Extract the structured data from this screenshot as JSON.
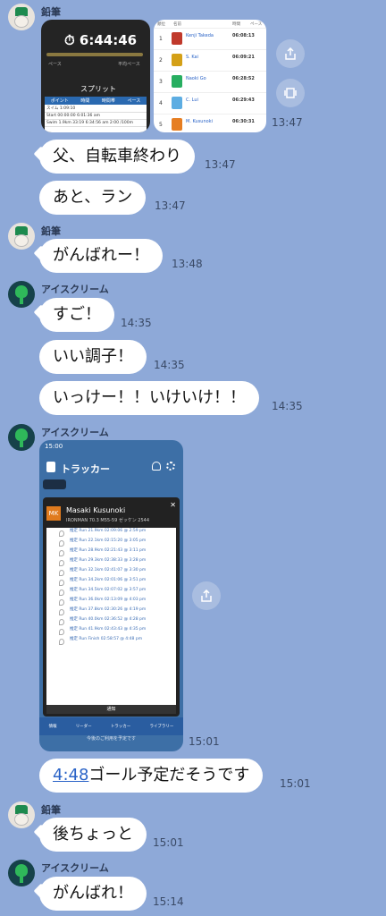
{
  "users": {
    "pencil": "鉛筆",
    "ice": "アイスクリーム"
  },
  "shot1": {
    "clock": "⏱ 6:44:46",
    "split_title": "スプリット",
    "pace_label": "ペース",
    "avg_pace_label": "平均ペース",
    "table_headers": [
      "ポイント",
      "時間",
      "時間帯",
      "ペース"
    ],
    "rows": [
      {
        "text": "スイム 1:09:10"
      },
      {
        "text": "Start 00:00:00  6:01:36 am"
      },
      {
        "text": "Swim 1.9km 33:19  6:34:56 am  2:00 /100m"
      }
    ]
  },
  "shot2": {
    "header": [
      "順位",
      "名前",
      "時間",
      "ペース"
    ],
    "rows": [
      {
        "rank": "1",
        "name": "Kenji Takeda",
        "time": "06:08:13",
        "color": "#c0392b"
      },
      {
        "rank": "2",
        "name": "S. Kai",
        "time": "06:09:21",
        "color": "#d4a017"
      },
      {
        "rank": "3",
        "name": "Naoki Go",
        "time": "06:28:52",
        "color": "#27ae60"
      },
      {
        "rank": "4",
        "name": "C. Lui",
        "time": "06:29:43",
        "color": "#5dade2"
      },
      {
        "rank": "5",
        "name": "M. Kusunoki",
        "time": "06:30:31",
        "color": "#e67e22"
      }
    ]
  },
  "messages": {
    "m1": {
      "text": "父、自転車終わり",
      "time": "13:47"
    },
    "m2": {
      "text": "あと、ラン",
      "time": "13:47"
    },
    "m3": {
      "text": "がんばれー！",
      "time": "13:48"
    },
    "m4": {
      "text": "すご！",
      "time": "14:35"
    },
    "m5": {
      "text": "いい調子！",
      "time": "14:35"
    },
    "m6": {
      "text": "いっけー！！いけいけ！！",
      "time": "14:35"
    },
    "m7": {
      "link": "4:48",
      "text": "ゴール予定だそうです",
      "time": "15:01"
    },
    "m8": {
      "text": "後ちょっと",
      "time": "15:01"
    },
    "m9": {
      "text": "がんばれ！",
      "time": "15:14"
    },
    "img_time1": "13:47",
    "img_time2": "15:01"
  },
  "tracker": {
    "status_time": "15:00",
    "title": "トラッカー",
    "athlete_initials": "MK",
    "athlete_name": "Masaki Kusunoki",
    "athlete_sub": "IRONMAN 70.3 M55-59 ゼッケン 2544",
    "list": [
      "推定 Run 21.9km  02:09:06 @ 2:59 pm",
      "推定 Run 22.1km  02:15:20 @ 3:05 pm",
      "推定 Run 28.9km  02:21:43 @ 3:11 pm",
      "推定 Run 29.3km  02:38:33 @ 3:28 pm",
      "推定 Run 32.1km  02:41:07 @ 3:30 pm",
      "推定 Run 34.2km  02:01:06 @ 3:51 pm",
      "推定 Run 34.5km  02:07:02 @ 3:57 pm",
      "推定 Run 36.0km  02:13:09 @ 4:03 pm",
      "推定 Run 37.8km  02:30:26 @ 4:19 pm",
      "推定 Run 40.0km  02:36:52 @ 4:28 pm",
      "推定 Run 41.9km  02:43:43 @ 4:35 pm",
      "推定 Run Finish  02:58:57 @ 4:48 pm"
    ],
    "notice": "通知",
    "tabs": [
      "情報",
      "リーダー",
      "トラッカー",
      "ライブラリー"
    ],
    "footer": "今後のご利用を予定です"
  }
}
